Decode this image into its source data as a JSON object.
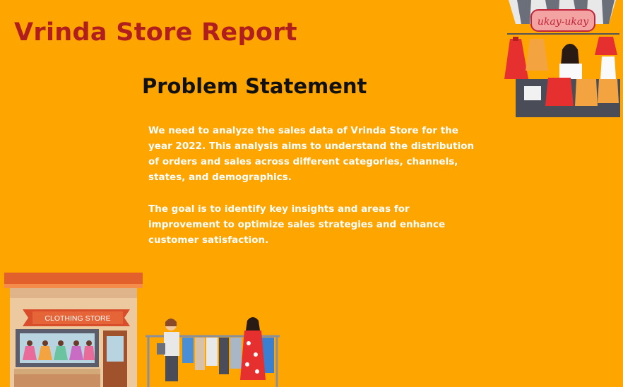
{
  "title": "Vrinda Store Report",
  "heading": "Problem Statement",
  "paragraphs": [
    "We need to analyze the sales data of Vrinda Store for the year 2022. This analysis aims to understand the distribution of orders and sales across different categories, channels, states, and demographics.",
    "The goal is to identify key insights and areas for improvement to optimize sales strategies and enhance customer satisfaction."
  ],
  "illustrations": {
    "stall_sign": "ukay-ukay",
    "store_sign": "CLOTHING STORE"
  },
  "colors": {
    "background": "#fea500",
    "title": "#b01e1e",
    "heading": "#111111",
    "body_text": "#ffffff"
  }
}
